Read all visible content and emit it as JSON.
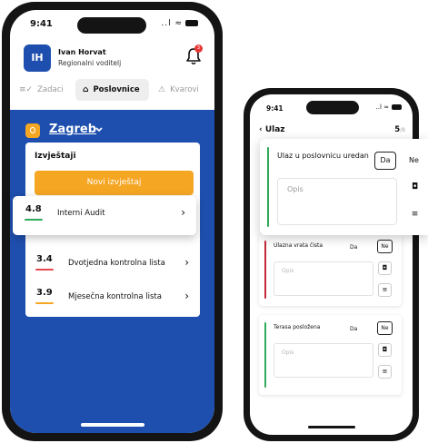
{
  "phone1": {
    "status_time": "9:41",
    "status_icons": "..l ≈",
    "user": {
      "initials": "IH",
      "name": "Ivan Horvat",
      "role": "Regionalni voditelj"
    },
    "notification_count": "3",
    "tabs": [
      {
        "label": "Zadaci",
        "icon": "≡✓"
      },
      {
        "label": "Poslovnice",
        "icon": "⌂"
      },
      {
        "label": "Kvarovi",
        "icon": "⚠"
      }
    ],
    "city": "Zagreb",
    "section_title": "Izvještaji",
    "new_report_label": "Novi izvještaj",
    "reports": [
      {
        "score": "4.8",
        "name": "Interni Audit",
        "color": "#2faa5a"
      },
      {
        "score": "3.4",
        "name": "Dvotjedna kontrolna lista",
        "color": "#e5484d"
      },
      {
        "score": "3.9",
        "name": "Mjesečna kontrolna lista",
        "color": "#f5a623"
      }
    ]
  },
  "phone2": {
    "status_time": "9:41",
    "status_icons": "..l ≈",
    "back_label": "Ulaz",
    "counter_main": "5",
    "counter_sub": "/8",
    "items": [
      {
        "title": "Ulaz u poslovnicu uredan",
        "yes": "Da",
        "no": "Ne",
        "placeholder": "Opis",
        "color": "#2faa5a"
      },
      {
        "title": "Ulazna vrata čista",
        "yes": "Da",
        "no": "Ne",
        "placeholder": "Opis",
        "color": "#c62839"
      },
      {
        "title": "Terasa posložena",
        "yes": "Da",
        "no": "Ne",
        "placeholder": "Opis",
        "color": "#2faa5a"
      }
    ]
  },
  "icons": {
    "back": "chevron-left-icon",
    "chevron": "chevron-right-icon",
    "camera": "camera-icon",
    "note": "note-edit-icon",
    "bell": "bell-icon",
    "pin": "location-pin-icon"
  }
}
